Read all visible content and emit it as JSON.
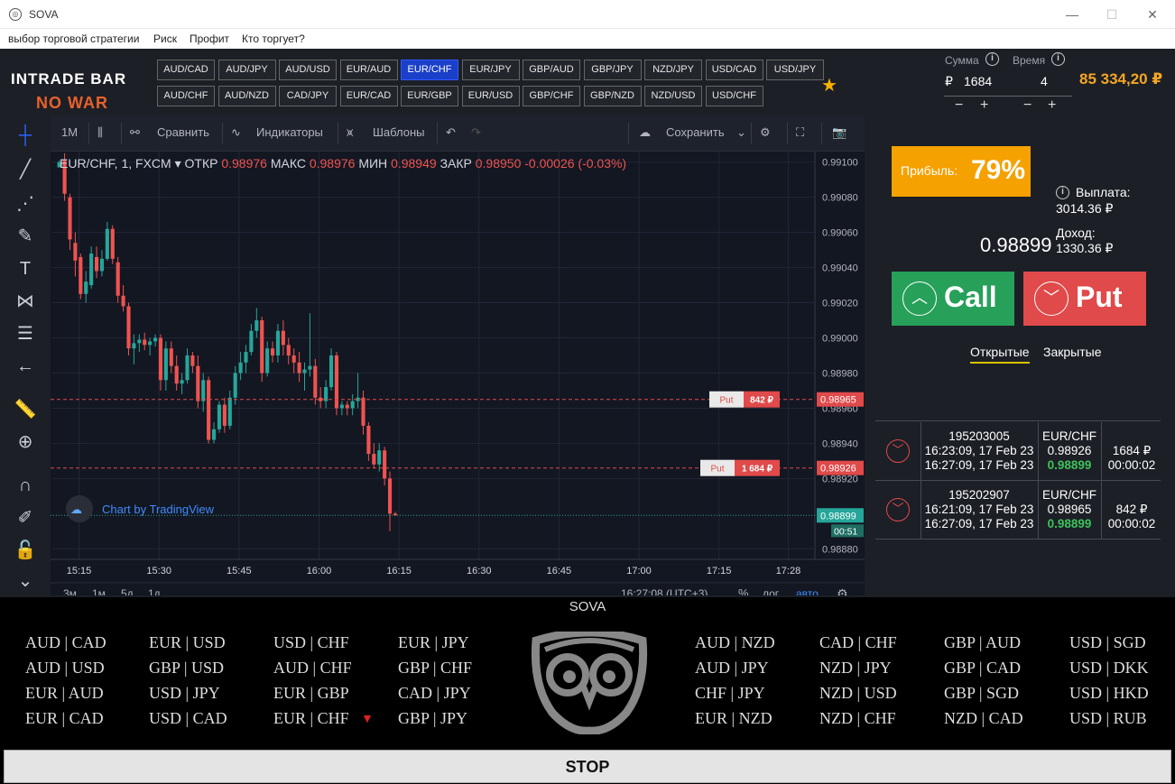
{
  "window": {
    "title": "SOVA",
    "controls": [
      "—",
      "☐",
      "✕"
    ]
  },
  "menu": [
    "выбор торговой стратегии",
    "Риск",
    "Профит",
    "Кто торгует?"
  ],
  "logo": {
    "line1": "INTRADE BAR",
    "line2": "NO WAR"
  },
  "pairs_row1": [
    "AUD/CAD",
    "AUD/JPY",
    "AUD/USD",
    "EUR/AUD",
    "EUR/CHF",
    "EUR/JPY",
    "GBP/AUD",
    "GBP/JPY",
    "NZD/JPY",
    "USD/CAD",
    "USD/JPY"
  ],
  "pairs_row2": [
    "AUD/CHF",
    "AUD/NZD",
    "CAD/JPY",
    "EUR/CAD",
    "EUR/GBP",
    "EUR/USD",
    "GBP/CHF",
    "GBP/NZD",
    "NZD/USD",
    "USD/CHF"
  ],
  "active_pair": "EUR/CHF",
  "amount": {
    "label": "Сумма",
    "currency": "₽",
    "value": "1684",
    "minus": "−",
    "plus": "+"
  },
  "time": {
    "label": "Время",
    "value": "4",
    "minus": "−",
    "plus": "+"
  },
  "balance": "85 334,20 ₽",
  "chart_toolbar": {
    "interval": "1M",
    "compare": "Сравнить",
    "indicators": "Индикаторы",
    "templates": "Шаблоны",
    "save": "Сохранить"
  },
  "chart_header": {
    "symbol": "EUR/CHF, 1, FXCM",
    "open_label": "ОТКР",
    "open": "0.98976",
    "high_label": "МАКС",
    "high": "0.98976",
    "low_label": "МИН",
    "low": "0.98949",
    "close_label": "ЗАКР",
    "close": "0.98950",
    "change": "-0.00026 (-0.03%)"
  },
  "chart_bottom": {
    "ranges": [
      "3м",
      "1м",
      "5д",
      "1д"
    ],
    "clock": "16:27:08 (UTC+3)",
    "pct": "%",
    "log": "лог",
    "auto": "авто"
  },
  "chart_watermark": "Chart by TradingView",
  "orders_on_chart": [
    {
      "type": "Put",
      "amount": "842 ₽",
      "price": 0.98965,
      "price_label": "0.98965"
    },
    {
      "type": "Put",
      "amount": "1 684 ₽",
      "price": 0.98926,
      "price_label": "0.98926"
    }
  ],
  "current_price_tag": {
    "price": 0.98899,
    "label": "0.98899",
    "countdown": "00:51"
  },
  "colors": {
    "up": "#26a69a",
    "down": "#ef5350",
    "accent_orange": "#f5a100",
    "call_green": "#27a05a",
    "put_red": "#e04a4a",
    "active_pair_blue": "#1a3fc9"
  },
  "chart_data": {
    "type": "candlestick",
    "symbol": "EUR/CHF, 1, FXCM",
    "y_ticks": [
      0.991,
      0.9908,
      0.9906,
      0.9904,
      0.9902,
      0.99,
      0.9898,
      0.9896,
      0.9894,
      0.9892,
      0.9888
    ],
    "y_tick_labels": [
      "0.99100",
      "0.99080",
      "0.99060",
      "0.99040",
      "0.99020",
      "0.99000",
      "0.98980",
      "0.98960",
      "0.98940",
      "0.98920",
      "0.98880"
    ],
    "ylim": [
      0.98874,
      0.99106
    ],
    "x_tick_labels": [
      "15:15",
      "15:30",
      "15:45",
      "16:00",
      "16:15",
      "16:30",
      "16:45",
      "17:00",
      "17:15",
      "17:28"
    ],
    "x_tick_minutes": [
      15,
      30,
      45,
      60,
      75,
      90,
      105,
      120,
      135,
      148
    ],
    "xlim_minutes": [
      10,
      153
    ],
    "candles": [
      [
        0,
        0.99097,
        0.99101,
        0.991,
        0.991
      ],
      [
        1,
        0.99101,
        0.99105,
        0.99078,
        0.99082
      ],
      [
        2,
        0.9908,
        0.99082,
        0.9905,
        0.99056
      ],
      [
        3,
        0.99054,
        0.9906,
        0.99035,
        0.99044
      ],
      [
        4,
        0.99046,
        0.99048,
        0.99022,
        0.99025
      ],
      [
        5,
        0.99025,
        0.99038,
        0.9902,
        0.99032
      ],
      [
        6,
        0.9903,
        0.99052,
        0.99028,
        0.99048
      ],
      [
        7,
        0.99046,
        0.99052,
        0.99034,
        0.99038
      ],
      [
        8,
        0.99038,
        0.9905,
        0.99035,
        0.99045
      ],
      [
        9,
        0.99045,
        0.99066,
        0.99044,
        0.99062
      ],
      [
        10,
        0.99062,
        0.99064,
        0.99042,
        0.99045
      ],
      [
        11,
        0.99043,
        0.99046,
        0.9902,
        0.99024
      ],
      [
        12,
        0.99024,
        0.9903,
        0.99015,
        0.99018
      ],
      [
        13,
        0.99018,
        0.9902,
        0.9899,
        0.98994
      ],
      [
        14,
        0.98994,
        0.99002,
        0.98985,
        0.98997
      ],
      [
        15,
        0.98997,
        0.99002,
        0.98992,
        0.98999
      ],
      [
        16,
        0.98999,
        0.99003,
        0.98993,
        0.98996
      ],
      [
        17,
        0.98996,
        0.99,
        0.9899,
        0.98998
      ],
      [
        18,
        0.98998,
        0.99002,
        0.98995,
        0.99
      ],
      [
        19,
        0.99,
        0.99002,
        0.9897,
        0.98976
      ],
      [
        20,
        0.98976,
        0.98998,
        0.9897,
        0.98994
      ],
      [
        21,
        0.98994,
        0.98998,
        0.9898,
        0.98984
      ],
      [
        22,
        0.98984,
        0.9899,
        0.9897,
        0.98974
      ],
      [
        23,
        0.98974,
        0.9898,
        0.98968,
        0.98976
      ],
      [
        24,
        0.98976,
        0.98994,
        0.98974,
        0.9899
      ],
      [
        25,
        0.9899,
        0.98992,
        0.9898,
        0.98984
      ],
      [
        26,
        0.98984,
        0.9899,
        0.9896,
        0.98964
      ],
      [
        27,
        0.98964,
        0.9898,
        0.98958,
        0.98976
      ],
      [
        28,
        0.98976,
        0.98978,
        0.9894,
        0.98942
      ],
      [
        29,
        0.98942,
        0.98952,
        0.9894,
        0.98948
      ],
      [
        30,
        0.98948,
        0.98964,
        0.98946,
        0.98962
      ],
      [
        31,
        0.98962,
        0.98966,
        0.98946,
        0.9895
      ],
      [
        32,
        0.9895,
        0.9897,
        0.98948,
        0.98966
      ],
      [
        33,
        0.98966,
        0.98984,
        0.98962,
        0.9898
      ],
      [
        34,
        0.9898,
        0.98992,
        0.98976,
        0.98986
      ],
      [
        35,
        0.98986,
        0.98996,
        0.9898,
        0.98992
      ],
      [
        36,
        0.98992,
        0.99008,
        0.9899,
        0.99004
      ],
      [
        37,
        0.99004,
        0.99017,
        0.99,
        0.9901
      ],
      [
        38,
        0.9901,
        0.99012,
        0.98975,
        0.9898
      ],
      [
        39,
        0.9898,
        0.98998,
        0.98978,
        0.98994
      ],
      [
        40,
        0.98994,
        0.98998,
        0.98986,
        0.9899
      ],
      [
        41,
        0.9899,
        0.99008,
        0.98986,
        0.99004
      ],
      [
        42,
        0.99004,
        0.9901,
        0.9899,
        0.98996
      ],
      [
        43,
        0.98996,
        0.99,
        0.98985,
        0.9899
      ],
      [
        44,
        0.9899,
        0.98994,
        0.9898,
        0.98986
      ],
      [
        45,
        0.98986,
        0.98992,
        0.98975,
        0.9898
      ],
      [
        46,
        0.9898,
        0.98986,
        0.9897,
        0.98982
      ],
      [
        47,
        0.98982,
        0.99014,
        0.98978,
        0.98984
      ],
      [
        48,
        0.98984,
        0.98988,
        0.98962,
        0.98966
      ],
      [
        49,
        0.98966,
        0.98972,
        0.9896,
        0.98964
      ],
      [
        50,
        0.98964,
        0.98976,
        0.9896,
        0.98972
      ],
      [
        51,
        0.98972,
        0.98994,
        0.9897,
        0.9899
      ],
      [
        52,
        0.9899,
        0.98992,
        0.98956,
        0.9896
      ],
      [
        53,
        0.9896,
        0.98964,
        0.98956,
        0.98962
      ],
      [
        54,
        0.98962,
        0.98964,
        0.98956,
        0.9896
      ],
      [
        55,
        0.9896,
        0.98968,
        0.98956,
        0.98964
      ],
      [
        56,
        0.98964,
        0.9898,
        0.9896,
        0.98966
      ],
      [
        57,
        0.98966,
        0.9897,
        0.98945,
        0.9895
      ],
      [
        58,
        0.9895,
        0.98952,
        0.9893,
        0.98934
      ],
      [
        59,
        0.98934,
        0.9894,
        0.98926,
        0.98928
      ],
      [
        60,
        0.98928,
        0.9894,
        0.98924,
        0.98936
      ],
      [
        61,
        0.98936,
        0.98938,
        0.98916,
        0.9892
      ],
      [
        62,
        0.9892,
        0.98924,
        0.9889,
        0.989
      ],
      [
        63,
        0.989,
        0.98901,
        0.98899,
        0.98899
      ]
    ],
    "candle_x_offset_minutes": 11.3,
    "candle_step_minutes": 1
  },
  "payout": {
    "profit_label": "Прибыль:",
    "profit_pct": "79%",
    "payout_label": "Выплата:",
    "payout_value": "3014.36 ₽",
    "income_label": "Доход:",
    "income_value": "1330.36 ₽"
  },
  "current_price": "0.98899",
  "call_label": "Call",
  "put_label": "Put",
  "order_tabs": {
    "open": "Открытые",
    "closed": "Закрытые"
  },
  "trades": [
    {
      "id": "195203005",
      "open_time": "16:23:09, 17 Feb 23",
      "close_time": "16:27:09, 17 Feb 23",
      "pair": "EUR/CHF",
      "open_price": "0.98926",
      "current": "0.98899",
      "amount": "1684 ₽",
      "remaining": "00:00:02"
    },
    {
      "id": "195202907",
      "open_time": "16:21:09, 17 Feb 23",
      "close_time": "16:27:09, 17 Feb 23",
      "pair": "EUR/CHF",
      "open_price": "0.98965",
      "current": "0.98899",
      "amount": "842 ₽",
      "remaining": "00:00:02"
    }
  ],
  "sova": {
    "title": "SOVA",
    "stop": "STOP",
    "left_cols": [
      [
        "AUD | CAD",
        "AUD | USD",
        "EUR | AUD",
        "EUR | CAD"
      ],
      [
        "EUR | USD",
        "GBP | USD",
        "USD | JPY",
        "USD | CAD"
      ],
      [
        "USD | CHF",
        "AUD | CHF",
        "EUR | GBP",
        "EUR | CHF"
      ],
      [
        "EUR | JPY",
        "GBP | CHF",
        "CAD | JPY",
        "GBP | JPY"
      ]
    ],
    "right_cols": [
      [
        "AUD | NZD",
        "AUD | JPY",
        "CHF | JPY",
        "EUR | NZD"
      ],
      [
        "CAD | CHF",
        "NZD | JPY",
        "NZD | USD",
        "NZD | CHF"
      ],
      [
        "GBP | AUD",
        "GBP | CAD",
        "GBP | SGD",
        "NZD | CAD"
      ],
      [
        "USD | SGD",
        "USD | DKK",
        "USD | HKD",
        "USD | RUB"
      ]
    ],
    "signal": "▼"
  }
}
